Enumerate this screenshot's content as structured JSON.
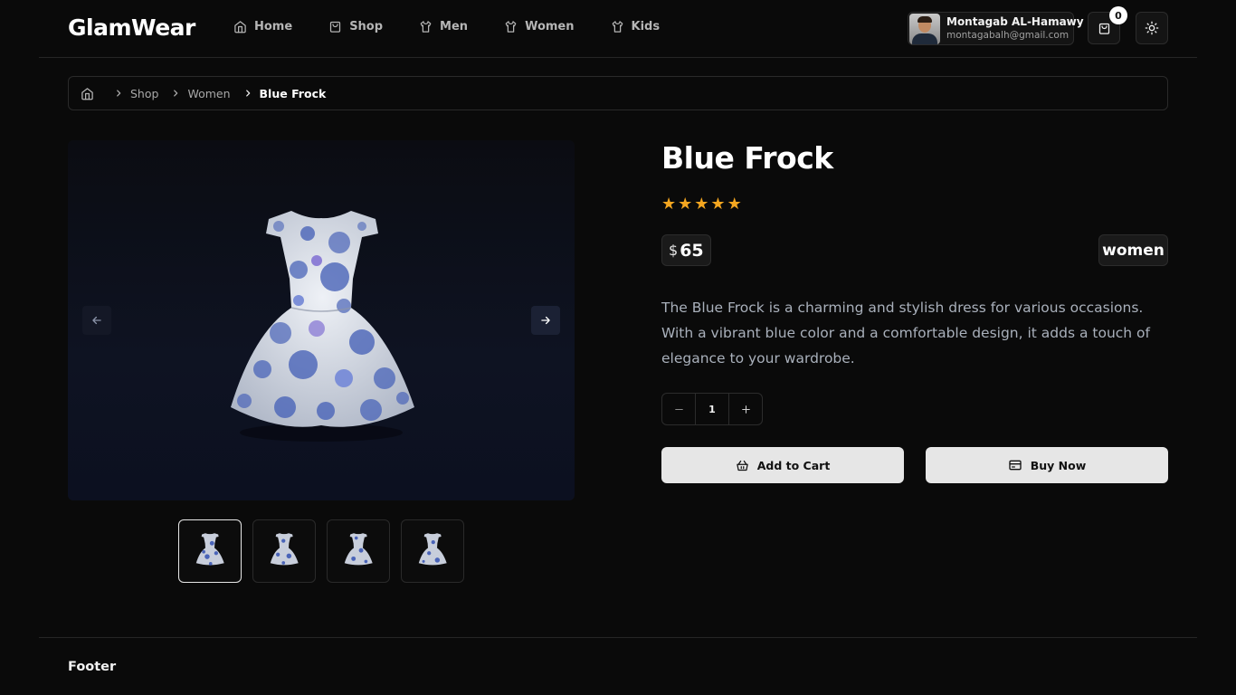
{
  "header": {
    "logo": "GlamWear",
    "nav": [
      {
        "label": "Home",
        "icon": "home-icon"
      },
      {
        "label": "Shop",
        "icon": "shopping-bag-icon"
      },
      {
        "label": "Men",
        "icon": "shirt-icon"
      },
      {
        "label": "Women",
        "icon": "shirt-icon"
      },
      {
        "label": "Kids",
        "icon": "shirt-icon"
      }
    ],
    "user": {
      "name": "Montagab AL-Hamawy",
      "email": "montagabalh@gmail.com"
    },
    "cart_count": "0"
  },
  "breadcrumb": {
    "items": [
      "Shop",
      "Women"
    ],
    "current": "Blue Frock"
  },
  "product": {
    "title": "Blue Frock",
    "rating": 5,
    "rating_max": 5,
    "currency": "$",
    "price": "65",
    "category": "women",
    "description": "The Blue Frock is a charming and stylish dress for various occasions. With a vibrant blue color and a comfortable design, it adds a touch of elegance to your wardrobe.",
    "quantity": "1",
    "add_to_cart_label": "Add to Cart",
    "buy_now_label": "Buy Now"
  },
  "gallery": {
    "thumbnail_count": 4,
    "active_index": 0
  },
  "footer": {
    "text": "Footer"
  },
  "colors": {
    "background": "#0a0a0a",
    "star": "#f4a620",
    "button_bg": "#e6e6e6",
    "dress_base": "#dfe3ea",
    "dress_dots": "#4a64b8"
  }
}
